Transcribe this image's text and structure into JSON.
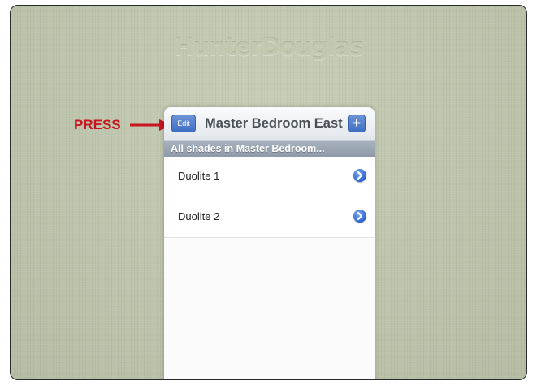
{
  "brand": {
    "logo_text": "HunterDouglas"
  },
  "annotation": {
    "label": "PRESS",
    "color": "#c8141e"
  },
  "navbar": {
    "edit_label": "Edit",
    "title": "Master Bedroom East",
    "add_label": "+"
  },
  "section": {
    "header": "All shades in Master Bedroom..."
  },
  "shades": [
    {
      "name": "Duolite 1"
    },
    {
      "name": "Duolite 2"
    }
  ],
  "icons": {
    "disclosure": "chevron-right-circle-icon",
    "arrow": "arrow-right-icon"
  },
  "colors": {
    "accent_button": "#4a78c9",
    "background": "#bfc6ae",
    "section_header": "#98a3b0"
  }
}
